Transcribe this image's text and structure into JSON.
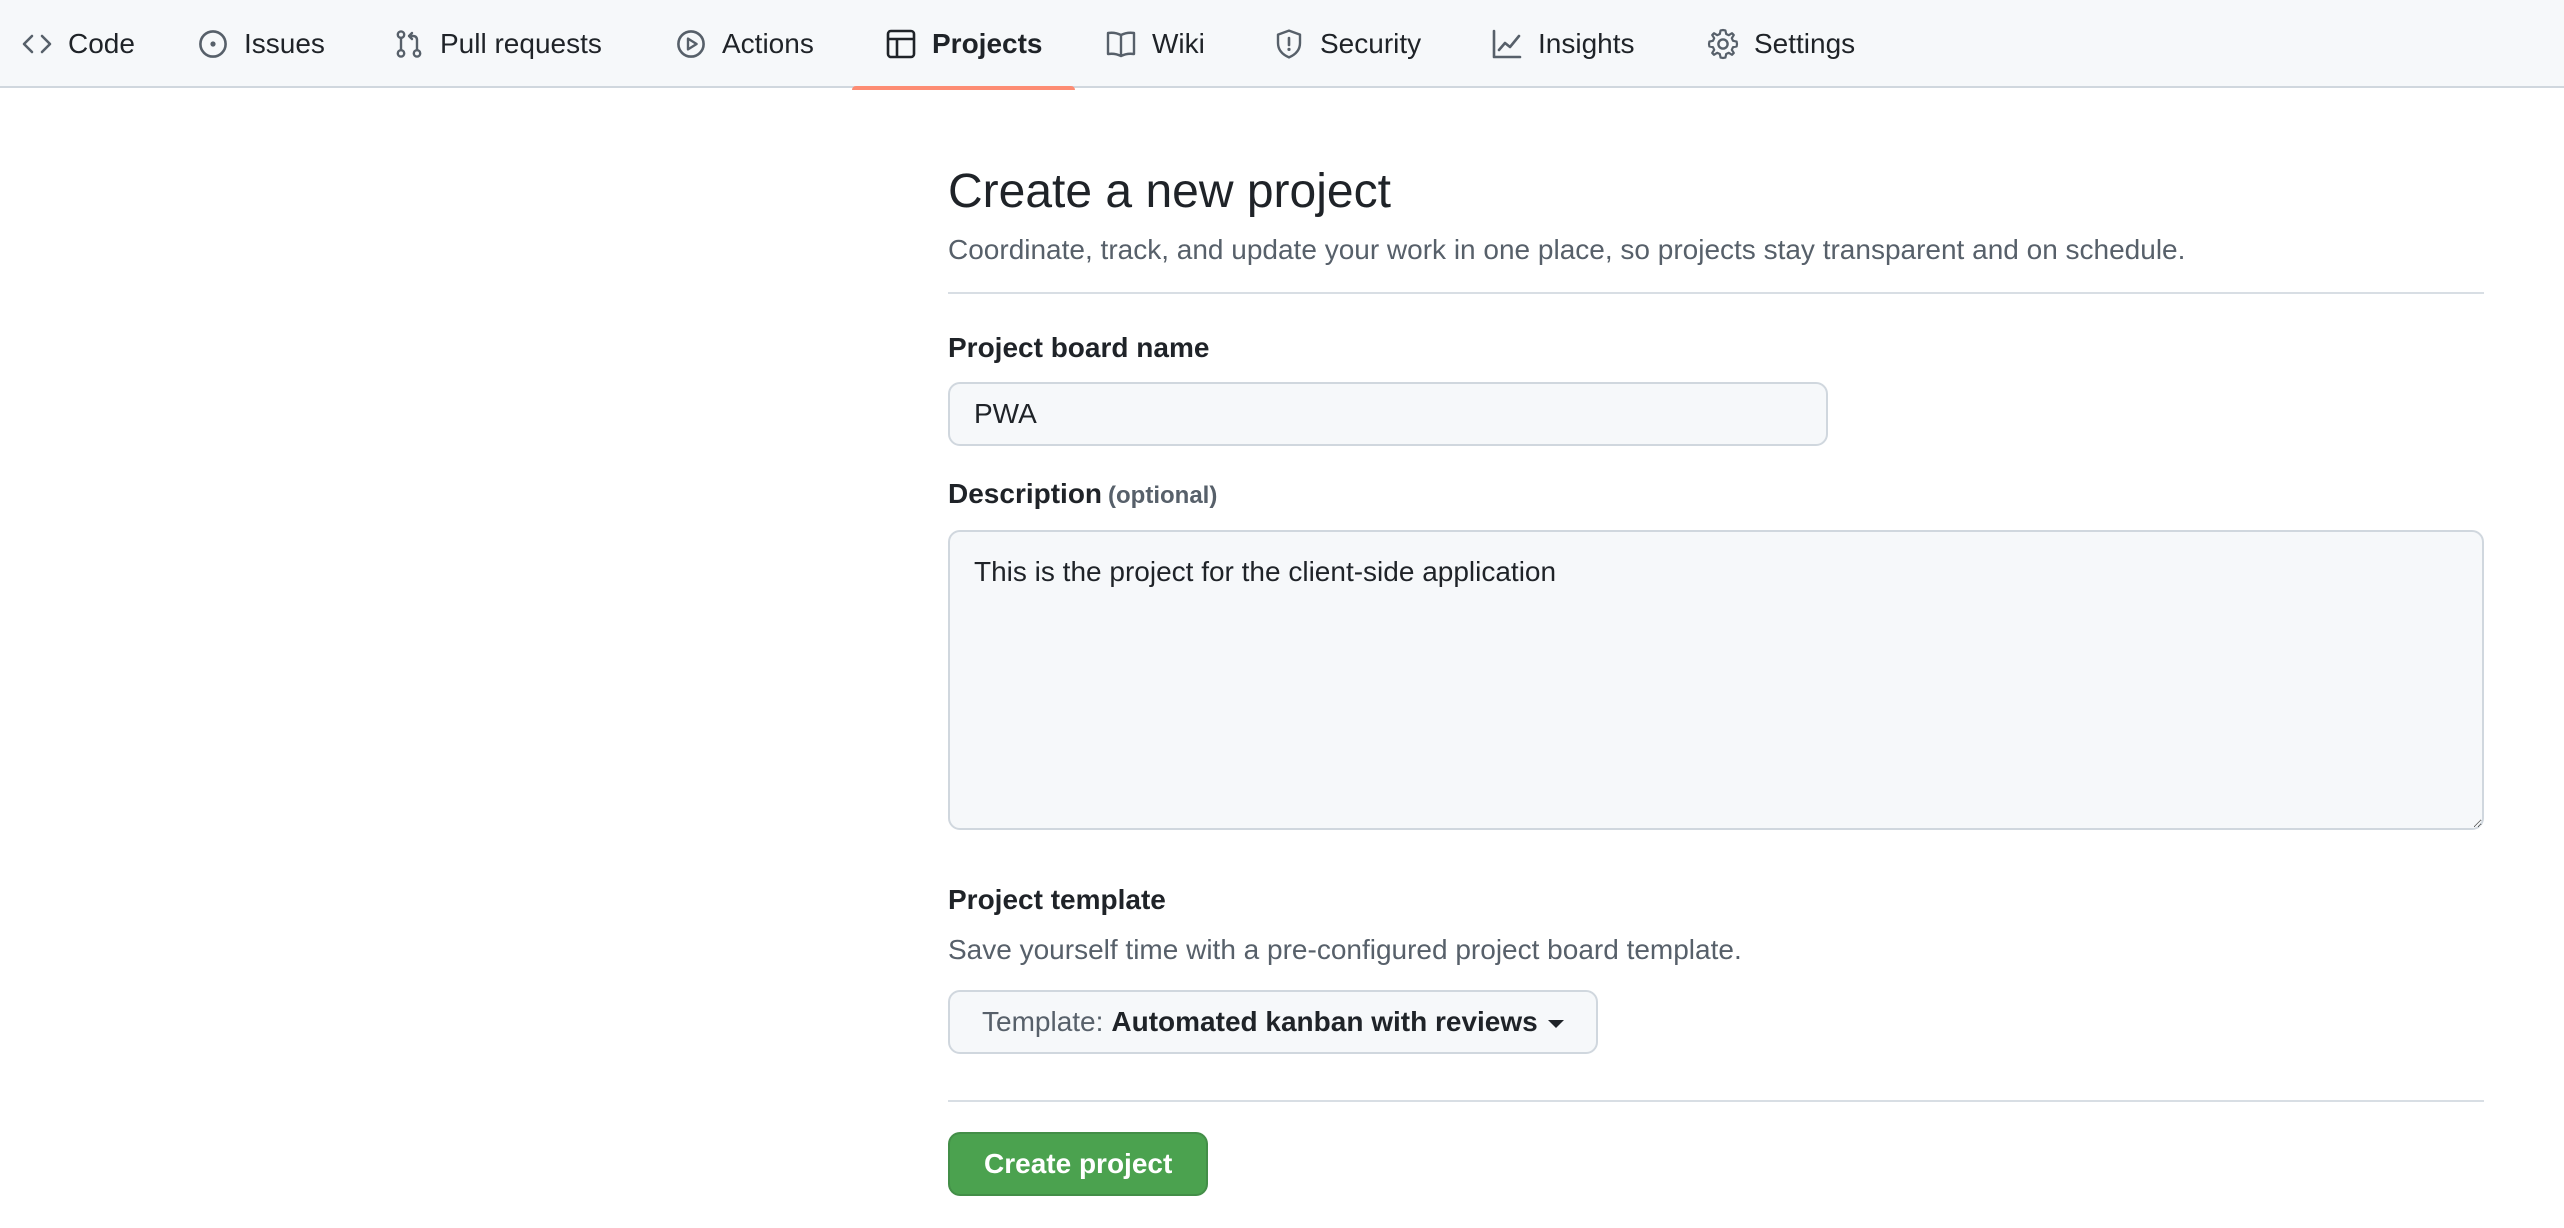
{
  "nav": {
    "tabs": [
      {
        "label": "Code",
        "icon": "code-icon"
      },
      {
        "label": "Issues",
        "icon": "issue-opened-icon"
      },
      {
        "label": "Pull requests",
        "icon": "git-pull-request-icon"
      },
      {
        "label": "Actions",
        "icon": "play-icon"
      },
      {
        "label": "Projects",
        "icon": "table-icon",
        "selected": true
      },
      {
        "label": "Wiki",
        "icon": "book-icon"
      },
      {
        "label": "Security",
        "icon": "shield-icon"
      },
      {
        "label": "Insights",
        "icon": "graph-icon"
      },
      {
        "label": "Settings",
        "icon": "gear-icon"
      }
    ],
    "selected_underline_color": "#fd8c73"
  },
  "page": {
    "title": "Create a new project",
    "subtitle": "Coordinate, track, and update your work in one place, so projects stay transparent and on schedule."
  },
  "form": {
    "name_label": "Project board name",
    "name_value": "PWA",
    "description_label": "Description",
    "description_optional": "(optional)",
    "description_value": "This is the project for the client-side application",
    "template_label": "Project template",
    "template_help": "Save yourself time with a pre-configured project board template.",
    "template_prefix": "Template:",
    "template_value": "Automated kanban with reviews",
    "submit_label": "Create project",
    "submit_color": "#4ba24f"
  }
}
